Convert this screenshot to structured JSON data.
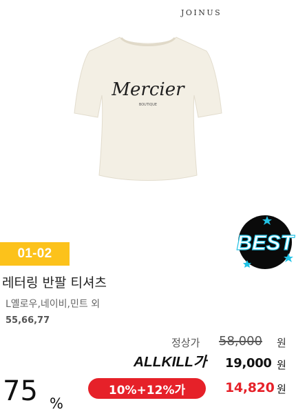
{
  "brand": "JOINUS",
  "product": {
    "print_text": "Mercier",
    "print_subtext": "BOUTIQUE",
    "code": "01-02",
    "title": "레터링 반팔 티셔츠",
    "colors": "L옐로우,네이비,민트 외",
    "sizes": "55,66,77"
  },
  "best_badge": {
    "label": "BEST"
  },
  "pricing": {
    "regular_label": "정상가",
    "regular_price": "58,000",
    "allkill_label": "ALLKILL가",
    "sale_price": "19,000",
    "coupon_label": "10%+12%가",
    "final_price": "14,820",
    "currency": "원",
    "discount_rate": "75",
    "percent_sign": "%"
  },
  "colors": {
    "code_badge": "#fcc21b",
    "accent_red": "#e62129",
    "shirt": "#f3efe4",
    "best_bg": "#0a0a0a",
    "best_star": "#22c3e6"
  }
}
